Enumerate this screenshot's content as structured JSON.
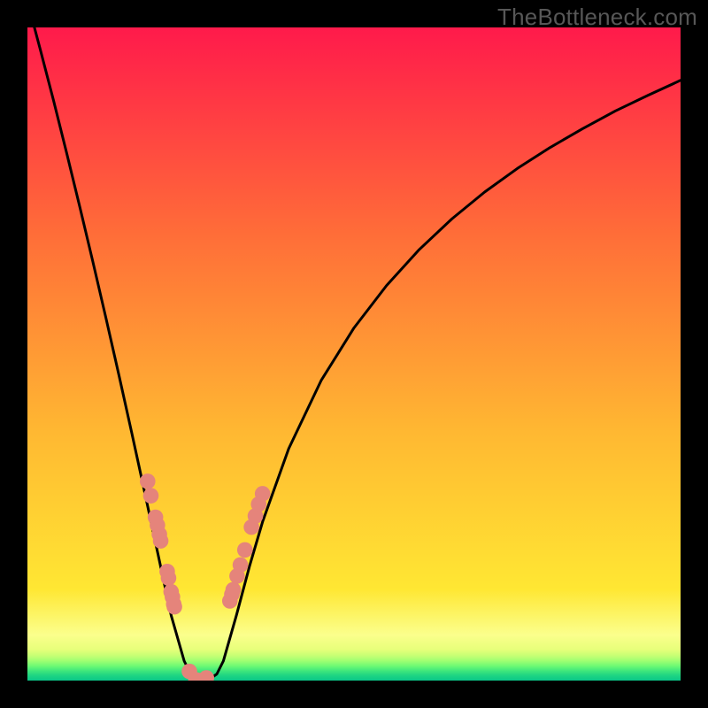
{
  "watermark": "TheBottleneck.com",
  "chart_data": {
    "type": "line",
    "title": "",
    "xlabel": "",
    "ylabel": "",
    "xlim": [
      0,
      100
    ],
    "ylim": [
      0,
      100
    ],
    "series": [
      {
        "name": "bottleneck-curve",
        "x": [
          0,
          2,
          4,
          6,
          8,
          10,
          12,
          14,
          16,
          18,
          20,
          22,
          24,
          25,
          26,
          27,
          28,
          29,
          30,
          32,
          34,
          36,
          40,
          45,
          50,
          55,
          60,
          65,
          70,
          75,
          80,
          85,
          90,
          95,
          100
        ],
        "values": [
          104,
          96.5,
          88.8,
          80.8,
          72.6,
          64.2,
          55.6,
          46.8,
          37.8,
          28.6,
          19.3,
          10.0,
          3.0,
          1.0,
          0.3,
          0.1,
          0.3,
          1.0,
          3.0,
          10.0,
          17.5,
          24.3,
          35.5,
          46.0,
          54.0,
          60.5,
          66.0,
          70.7,
          74.8,
          78.4,
          81.6,
          84.5,
          87.2,
          89.6,
          91.9
        ]
      }
    ],
    "markers": {
      "name": "gpu-markers",
      "color": "#e5847b",
      "points": [
        [
          18.4,
          30.5
        ],
        [
          18.9,
          28.3
        ],
        [
          19.6,
          25.0
        ],
        [
          19.9,
          23.8
        ],
        [
          20.2,
          22.4
        ],
        [
          20.4,
          21.4
        ],
        [
          21.4,
          16.7
        ],
        [
          21.6,
          15.7
        ],
        [
          22.0,
          13.6
        ],
        [
          22.2,
          12.8
        ],
        [
          22.4,
          11.7
        ],
        [
          22.5,
          11.3
        ],
        [
          24.8,
          1.4
        ],
        [
          25.8,
          0.1
        ],
        [
          26.1,
          0.0
        ],
        [
          26.5,
          0.0
        ],
        [
          27.0,
          0.1
        ],
        [
          27.4,
          0.4
        ],
        [
          31.0,
          12.2
        ],
        [
          31.3,
          13.2
        ],
        [
          31.5,
          13.9
        ],
        [
          32.1,
          16.0
        ],
        [
          32.6,
          17.7
        ],
        [
          33.3,
          20.0
        ],
        [
          34.3,
          23.5
        ],
        [
          34.9,
          25.2
        ],
        [
          35.4,
          27.0
        ],
        [
          36.0,
          28.6
        ]
      ]
    },
    "gradient_bands": [
      {
        "y0": 100,
        "y1": 10,
        "from": "#ff1a4b",
        "to": "#ffe733"
      },
      {
        "y0": 10,
        "y1": 4.3,
        "from": "#ffe733",
        "to": "#fbff8c"
      },
      {
        "y0": 4.3,
        "y1": 3.4,
        "color": "#e8ff7b"
      },
      {
        "y0": 3.4,
        "y1": 2.8,
        "color": "#c6ff74"
      },
      {
        "y0": 2.8,
        "y1": 2.2,
        "color": "#9eff72"
      },
      {
        "y0": 2.2,
        "y1": 1.6,
        "color": "#6bf974"
      },
      {
        "y0": 1.6,
        "y1": 1.0,
        "color": "#40e77c"
      },
      {
        "y0": 1.0,
        "y1": 0.4,
        "color": "#1fd582"
      },
      {
        "y0": 0.4,
        "y1": 0.0,
        "color": "#0ac788"
      }
    ]
  }
}
